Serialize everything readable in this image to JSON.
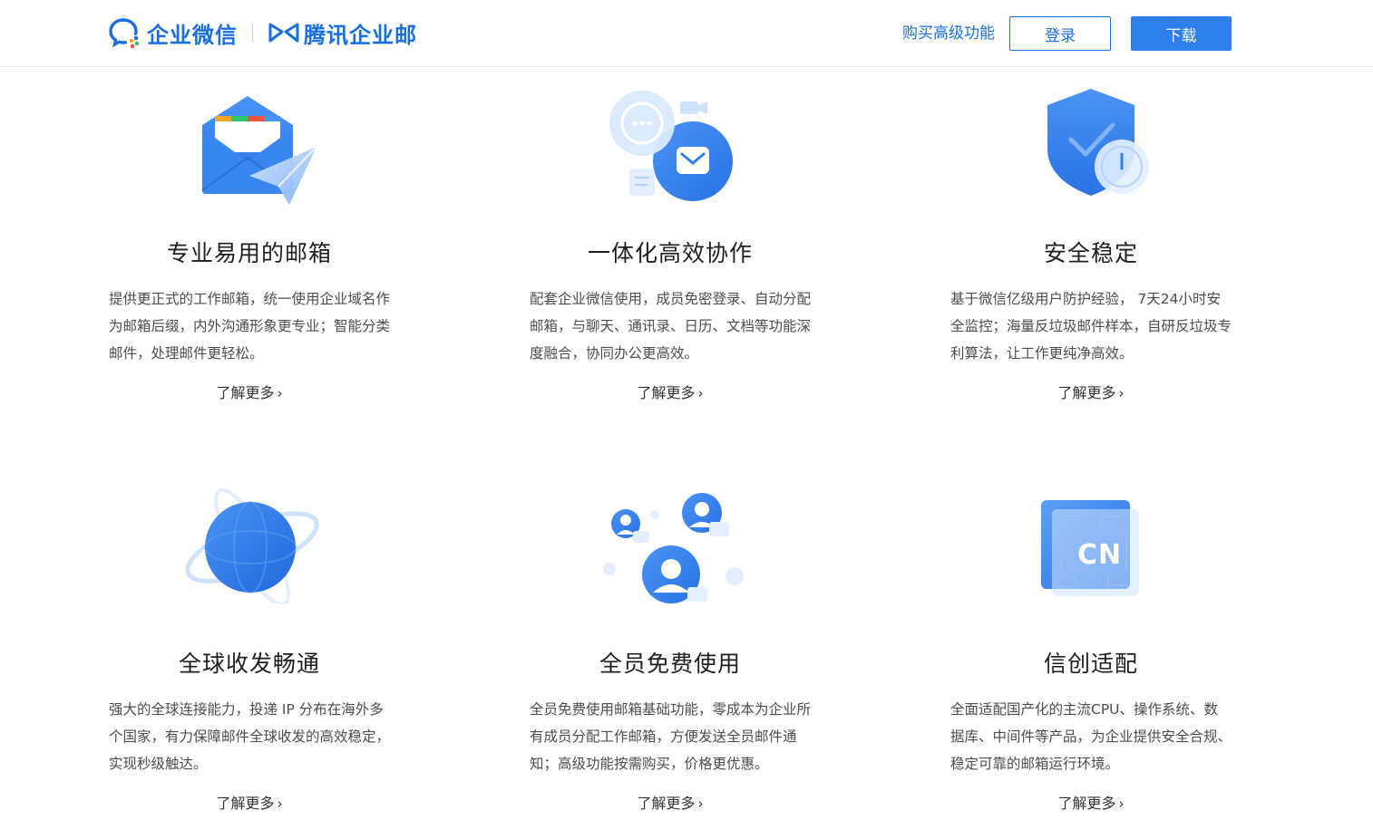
{
  "header": {
    "brand_primary": "企业微信",
    "brand_secondary": "腾讯企业邮",
    "buy_label": "购买高级功能",
    "login_label": "登录",
    "download_label": "下载"
  },
  "colors": {
    "accent": "#1a6fe0",
    "button_primary": "#2f80ed",
    "icon_blue": "#3a86f0",
    "icon_light": "#cfe3fd"
  },
  "features": [
    {
      "icon": "mail-envelope-icon",
      "title": "专业易用的邮箱",
      "desc": "提供更正式的工作邮箱，统一使用企业域名作为邮箱后缀，内外沟通形象更专业；智能分类邮件，处理邮件更轻松。",
      "link": "了解更多"
    },
    {
      "icon": "collaboration-icon",
      "title": "一体化高效协作",
      "desc": "配套企业微信使用，成员免密登录、自动分配邮箱，与聊天、通讯录、日历、文档等功能深度融合，协同办公更高效。",
      "link": "了解更多"
    },
    {
      "icon": "shield-icon",
      "title": "安全稳定",
      "desc": "基于微信亿级用户防护经验， 7天24小时安全监控；海量反垃圾邮件样本，自研反垃圾专利算法，让工作更纯净高效。",
      "link": "了解更多"
    },
    {
      "icon": "globe-icon",
      "title": "全球收发畅通",
      "desc": "强大的全球连接能力，投递 IP 分布在海外多个国家，有力保障邮件全球收发的高效稳定，实现秒级触达。",
      "link": "了解更多"
    },
    {
      "icon": "members-icon",
      "title": "全员免费使用",
      "desc": "全员免费使用邮箱基础功能，零成本为企业所有成员分配工作邮箱，方便发送全员邮件通知；高级功能按需购买，价格更优惠。",
      "link": "了解更多"
    },
    {
      "icon": "cn-chip-icon",
      "title": "信创适配",
      "desc": "全面适配国产化的主流CPU、操作系统、数据库、中间件等产品，为企业提供安全合规、稳定可靠的邮箱运行环境。",
      "link": "了解更多",
      "chip_text": "CN"
    }
  ]
}
